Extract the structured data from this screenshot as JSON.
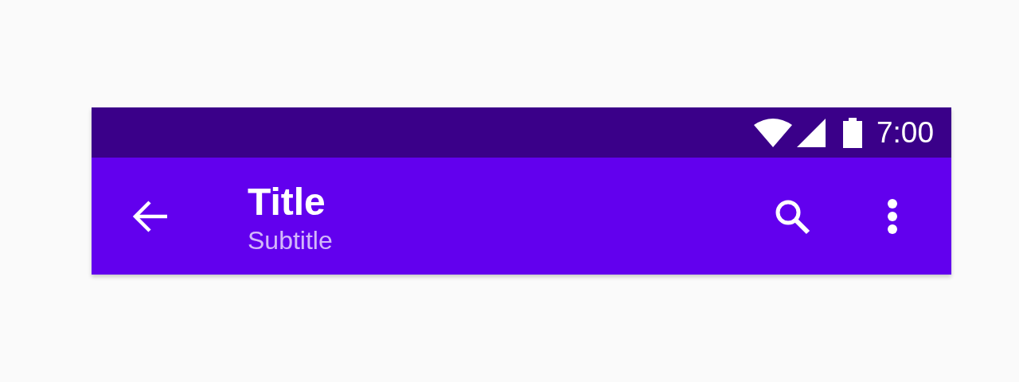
{
  "status_bar": {
    "time": "7:00"
  },
  "app_bar": {
    "title": "Title",
    "subtitle": "Subtitle"
  }
}
